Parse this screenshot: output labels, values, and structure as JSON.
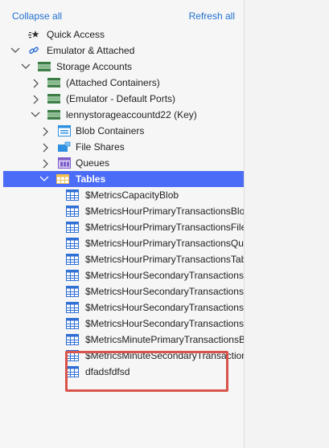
{
  "toolbar": {
    "collapse_label": "Collapse all",
    "refresh_label": "Refresh all"
  },
  "tree": {
    "quick_access": "Quick Access",
    "emulator_attached": "Emulator & Attached",
    "storage_accounts": "Storage Accounts",
    "attached_containers": "(Attached Containers)",
    "emulator_default_ports": "(Emulator - Default Ports)",
    "account_key": "lennystorageaccountd22 (Key)",
    "blob_containers": "Blob Containers",
    "file_shares": "File Shares",
    "queues": "Queues",
    "tables": "Tables",
    "table_items": [
      "$MetricsCapacityBlob",
      "$MetricsHourPrimaryTransactionsBlob",
      "$MetricsHourPrimaryTransactionsFile",
      "$MetricsHourPrimaryTransactionsQueue",
      "$MetricsHourPrimaryTransactionsTable",
      "$MetricsHourSecondaryTransactionsBlob",
      "$MetricsHourSecondaryTransactionsFile",
      "$MetricsHourSecondaryTransactionsQueue",
      "$MetricsHourSecondaryTransactionsTable",
      "$MetricsMinutePrimaryTransactionsBlob",
      "$MetricsMinuteSecondaryTransactionsBlob",
      "dfadsfdfsd"
    ]
  },
  "colors": {
    "selection": "#4a6cf6",
    "link": "#1f6fd0",
    "highlight_box": "#d9534a"
  }
}
